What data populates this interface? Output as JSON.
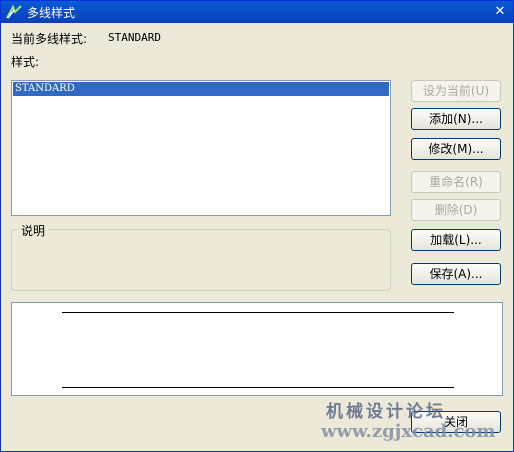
{
  "window": {
    "title": "多线样式",
    "close_glyph": "✕"
  },
  "current_style": {
    "label": "当前多线样式:",
    "value": "STANDARD"
  },
  "styles_label": "样式:",
  "styles_list": {
    "items": [
      "STANDARD"
    ],
    "selected": "STANDARD"
  },
  "description": {
    "label": "说明"
  },
  "buttons": {
    "set_current": "设为当前(U)",
    "add": "添加(N)...",
    "modify": "修改(M)...",
    "rename": "重命名(R)",
    "delete": "删除(D)",
    "load": "加载(L)...",
    "save": "保存(A)...",
    "close": "关闭"
  },
  "watermark": {
    "name": "机械设计论坛",
    "url": "www.zgjxcad.com"
  },
  "colors": {
    "titlebar": "#0a5ad6",
    "selection": "#316ac5",
    "dialog_bg": "#ece9d8"
  }
}
